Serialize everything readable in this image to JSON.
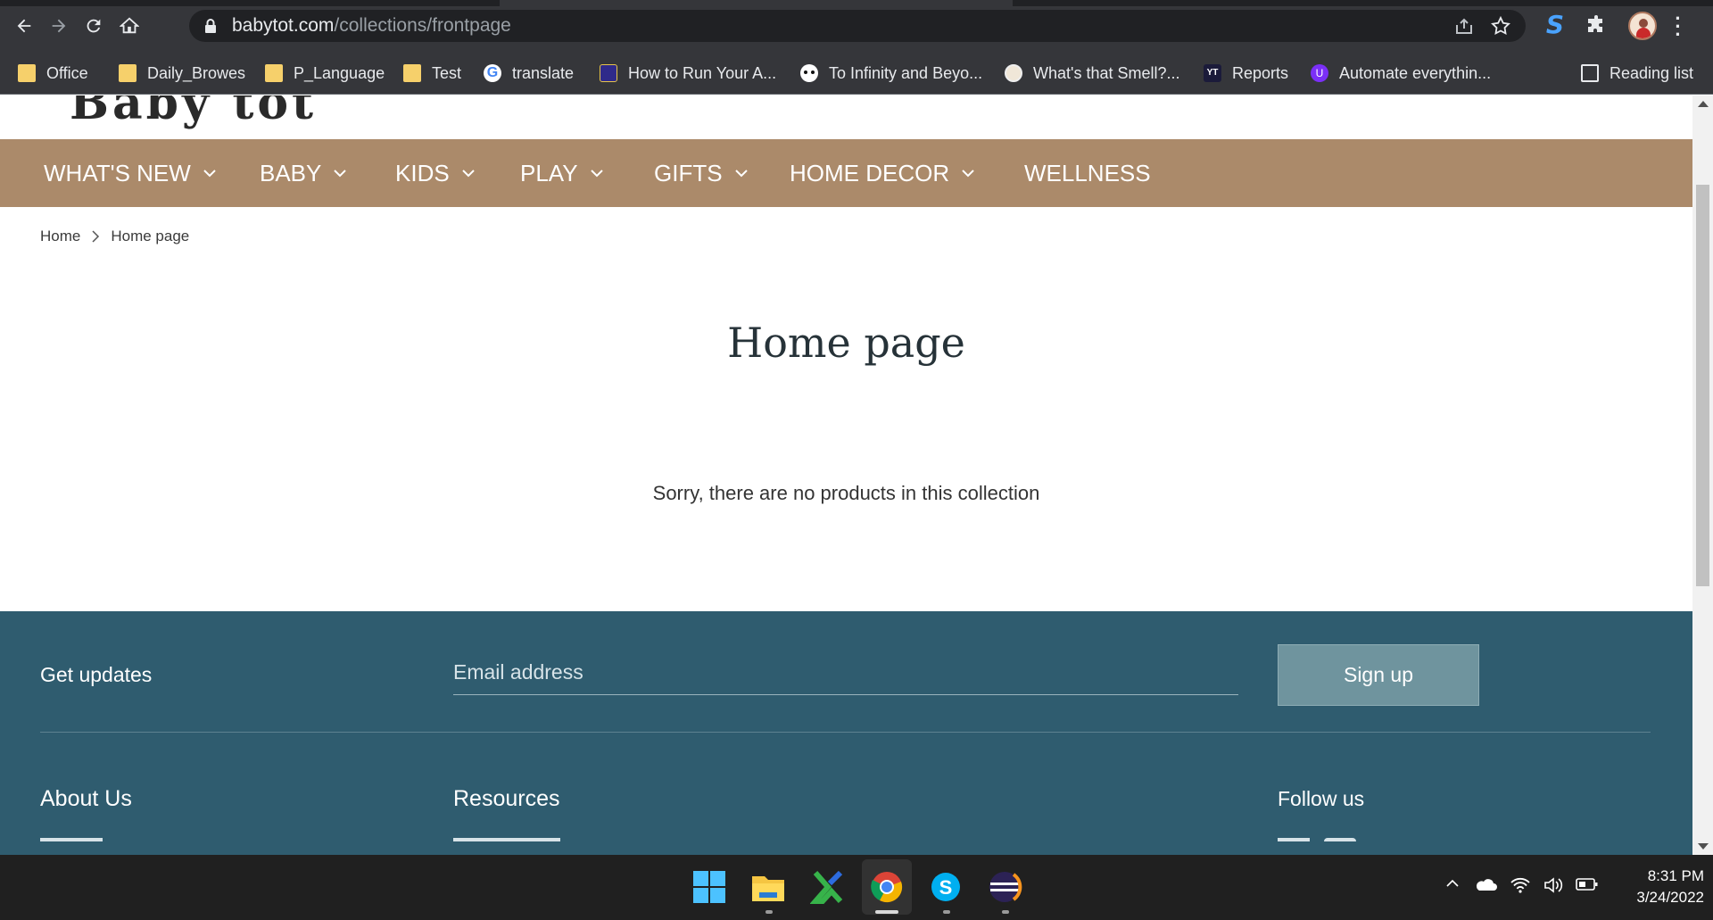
{
  "browser": {
    "url_host": "babytot.com",
    "url_path": "/collections/frontpage",
    "bookmarks": [
      {
        "label": "Office",
        "icon": "folder-icon"
      },
      {
        "label": "Daily_Browes",
        "icon": "folder-icon"
      },
      {
        "label": "P_Language",
        "icon": "folder-icon"
      },
      {
        "label": "Test",
        "icon": "folder-icon"
      },
      {
        "label": "translate",
        "icon": "google-icon"
      },
      {
        "label": "How to Run Your A...",
        "icon": "shield-icon"
      },
      {
        "label": "To Infinity and Beyo...",
        "icon": "panda-icon"
      },
      {
        "label": "What's that Smell?...",
        "icon": "smell-icon"
      },
      {
        "label": "Reports",
        "icon": "yt-icon"
      },
      {
        "label": "Automate everythin...",
        "icon": "automate-icon"
      }
    ],
    "reading_list": "Reading list"
  },
  "site": {
    "logo_text": "Baby tot",
    "menu": [
      {
        "label": "WHAT'S NEW",
        "has_dropdown": true
      },
      {
        "label": "BABY",
        "has_dropdown": true
      },
      {
        "label": "KIDS",
        "has_dropdown": true
      },
      {
        "label": "PLAY",
        "has_dropdown": true
      },
      {
        "label": "GIFTS",
        "has_dropdown": true
      },
      {
        "label": "HOME DECOR",
        "has_dropdown": true
      },
      {
        "label": "WELLNESS",
        "has_dropdown": false
      }
    ],
    "breadcrumb": {
      "home": "Home",
      "current": "Home page"
    },
    "page_title": "Home page",
    "empty_message": "Sorry, there are no products in this collection",
    "footer": {
      "get_updates": "Get updates",
      "email_placeholder": "Email address",
      "signup_label": "Sign up",
      "about_us": "About Us",
      "resources": "Resources",
      "follow_us": "Follow us"
    },
    "colors": {
      "menu_bar": "#ab8a6a",
      "footer_bg": "#2f5c6f",
      "signup_bg": "#6f949e"
    }
  },
  "taskbar": {
    "apps": [
      "windows-start-icon",
      "file-explorer-icon",
      "xmind-icon",
      "chrome-icon",
      "skype-icon",
      "eclipse-icon"
    ],
    "time": "8:31 PM",
    "date": "3/24/2022"
  }
}
